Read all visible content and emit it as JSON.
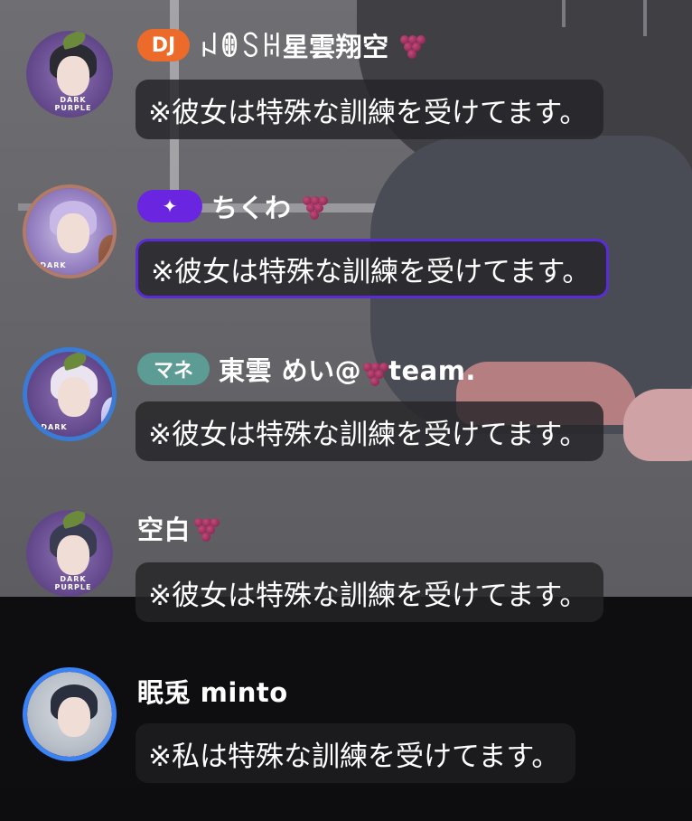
{
  "comments": [
    {
      "badge": "DJ",
      "username": "ꈤꂦꇙꀍ星雲翔空",
      "message": "※彼女は特殊な訓練を受けてます。",
      "avatar_icon": "avatar-dark-purple",
      "avatar_ring_text": "DARK PURPLE",
      "has_grape_emoji": true
    },
    {
      "badge": "✦",
      "username": "ちくわ",
      "message": "※彼女は特殊な訓練を受けてます。",
      "avatar_icon": "avatar-dark-purple",
      "avatar_ring_text": "DARK",
      "has_grape_emoji": true
    },
    {
      "badge": "マネ",
      "username": "東雲 めい@",
      "username_suffix": "team.",
      "message": "※彼女は特殊な訓練を受けてます。",
      "avatar_icon": "avatar-dark-purple",
      "avatar_ring_text": "DARK",
      "has_grape_emoji": true
    },
    {
      "badge": "",
      "username": "空白",
      "message": "※彼女は特殊な訓練を受けてます。",
      "avatar_icon": "avatar-dark-purple",
      "avatar_ring_text": "DARK PURPLE",
      "has_grape_emoji": true
    },
    {
      "badge": "",
      "username": "眠兎 minto",
      "message": "※私は特殊な訓練を受けてます。",
      "avatar_icon": "avatar-portrait",
      "has_grape_emoji": false
    }
  ],
  "colors": {
    "badge_dj": "#ec6b2a",
    "badge_spark": "#6a25e0",
    "badge_mane": "#5d9b95",
    "highlight_border": "#5a2bd6",
    "avatar_ring_blue": "#3a7bd5"
  }
}
